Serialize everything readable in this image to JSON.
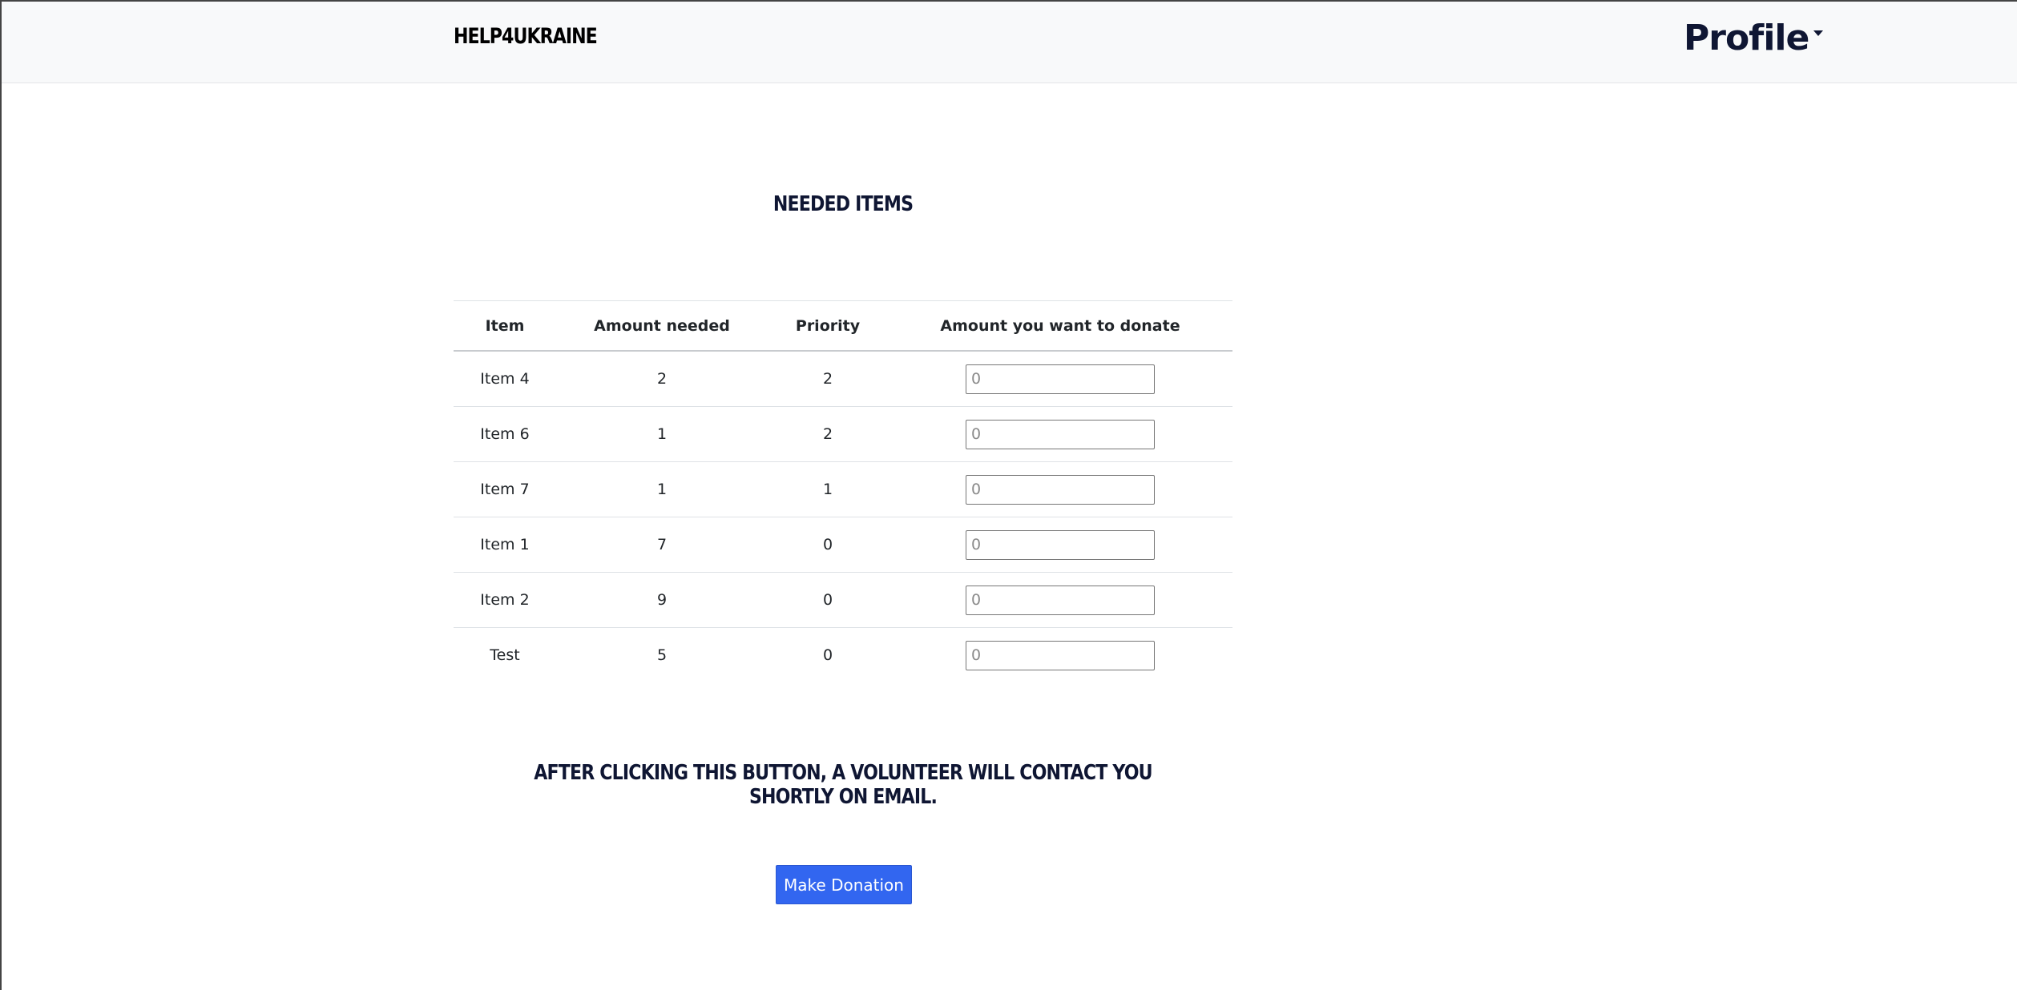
{
  "navbar": {
    "brand": "HELP4UKRAINE",
    "profile_label": "Profile"
  },
  "page": {
    "title": "NEEDED ITEMS",
    "notice": "AFTER CLICKING THIS BUTTON, A VOLUNTEER WILL CONTACT YOU SHORTLY ON EMAIL.",
    "donate_button": "Make Donation"
  },
  "table": {
    "headers": [
      "Item",
      "Amount needed",
      "Priority",
      "Amount you want to donate"
    ],
    "rows": [
      {
        "item": "Item 4",
        "amount_needed": "2",
        "priority": "2",
        "donate_placeholder": "0"
      },
      {
        "item": "Item 6",
        "amount_needed": "1",
        "priority": "2",
        "donate_placeholder": "0"
      },
      {
        "item": "Item 7",
        "amount_needed": "1",
        "priority": "1",
        "donate_placeholder": "0"
      },
      {
        "item": "Item 1",
        "amount_needed": "7",
        "priority": "0",
        "donate_placeholder": "0"
      },
      {
        "item": "Item 2",
        "amount_needed": "9",
        "priority": "0",
        "donate_placeholder": "0"
      },
      {
        "item": "Test",
        "amount_needed": "5",
        "priority": "0",
        "donate_placeholder": "0"
      }
    ]
  },
  "colors": {
    "navbar_bg": "#f8f9fa",
    "heading": "#0f1633",
    "button_bg": "#3266f0",
    "button_text": "#ffffff"
  }
}
